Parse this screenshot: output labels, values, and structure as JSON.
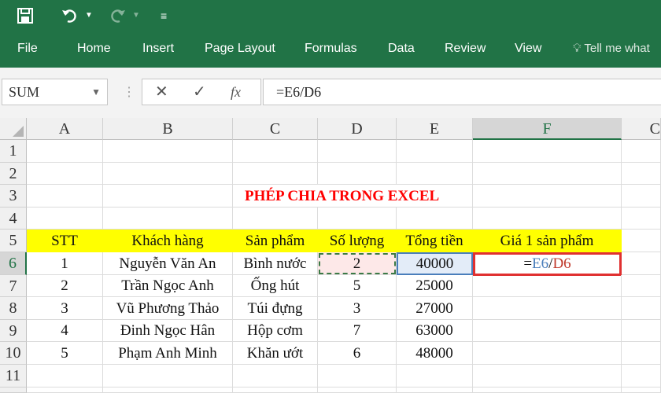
{
  "qat": {
    "save_icon": "save-icon",
    "undo_icon": "undo-icon",
    "redo_icon": "redo-icon",
    "customize_icon": "customize-qat-icon"
  },
  "ribbon": {
    "tabs": [
      "File",
      "Home",
      "Insert",
      "Page Layout",
      "Formulas",
      "Data",
      "Review",
      "View"
    ],
    "tell_me": "Tell me what"
  },
  "formula_bar": {
    "name_box": "SUM",
    "formula": "=E6/D6",
    "fx_label": "fx"
  },
  "columns": [
    "A",
    "B",
    "C",
    "D",
    "E",
    "F",
    "C"
  ],
  "rows": [
    "1",
    "2",
    "3",
    "4",
    "5",
    "6",
    "7",
    "8",
    "9",
    "10",
    "11"
  ],
  "sheet": {
    "title": "PHÉP CHIA TRONG EXCEL",
    "headers": [
      "STT",
      "Khách hàng",
      "Sản phẩm",
      "Số lượng",
      "Tổng tiền",
      "Giá 1 sản phẩm"
    ],
    "data": [
      [
        "1",
        "Nguyễn Văn An",
        "Bình nước",
        "2",
        "40000"
      ],
      [
        "2",
        "Trần Ngọc Anh",
        "Ống hút",
        "5",
        "25000"
      ],
      [
        "3",
        "Vũ Phương Thảo",
        "Túi đựng",
        "3",
        "27000"
      ],
      [
        "4",
        "Đinh Ngọc Hân",
        "Hộp cơm",
        "7",
        "63000"
      ],
      [
        "5",
        "Phạm Anh Minh",
        "Khăn ướt",
        "6",
        "48000"
      ]
    ],
    "active_cell_formula": {
      "eq": "=",
      "ref1": "E6",
      "slash": "/",
      "ref2": "D6"
    }
  },
  "colors": {
    "excel_green": "#217346",
    "header_fill": "#ffff00",
    "title_red": "#ff0000",
    "ref_blue": "#4a7ebb",
    "ref_red": "#c0392b"
  }
}
